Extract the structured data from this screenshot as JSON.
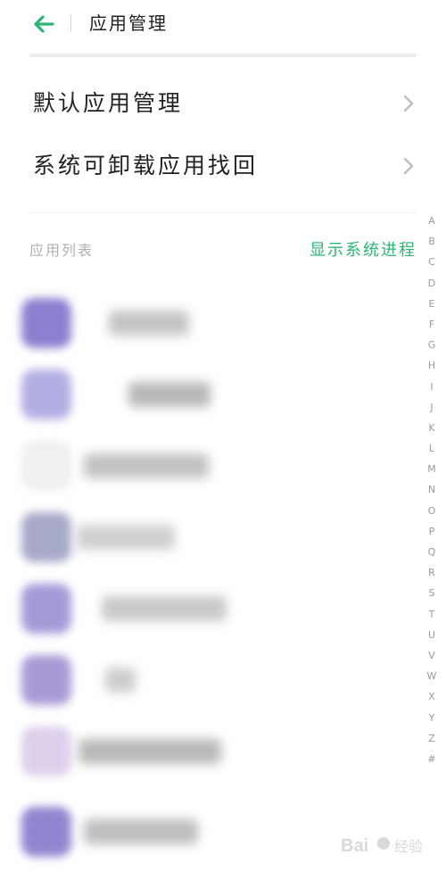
{
  "header": {
    "title": "应用管理",
    "back_icon": "arrow-left-icon",
    "accent_color": "#2bb673"
  },
  "menu": {
    "items": [
      {
        "label": "默认应用管理",
        "icon": "chevron-right-icon"
      },
      {
        "label": "系统可卸载应用找回",
        "icon": "chevron-right-icon"
      }
    ]
  },
  "app_list": {
    "section_title": "应用列表",
    "show_system_label": "显示系统进程",
    "index_letters": [
      "A",
      "B",
      "C",
      "D",
      "E",
      "F",
      "G",
      "H",
      "I",
      "J",
      "K",
      "L",
      "M",
      "N",
      "O",
      "P",
      "Q",
      "R",
      "S",
      "T",
      "U",
      "V",
      "W",
      "X",
      "Y",
      "Z",
      "#"
    ],
    "rows_obscured": true
  },
  "watermark": {
    "text": "Bai 经验"
  }
}
